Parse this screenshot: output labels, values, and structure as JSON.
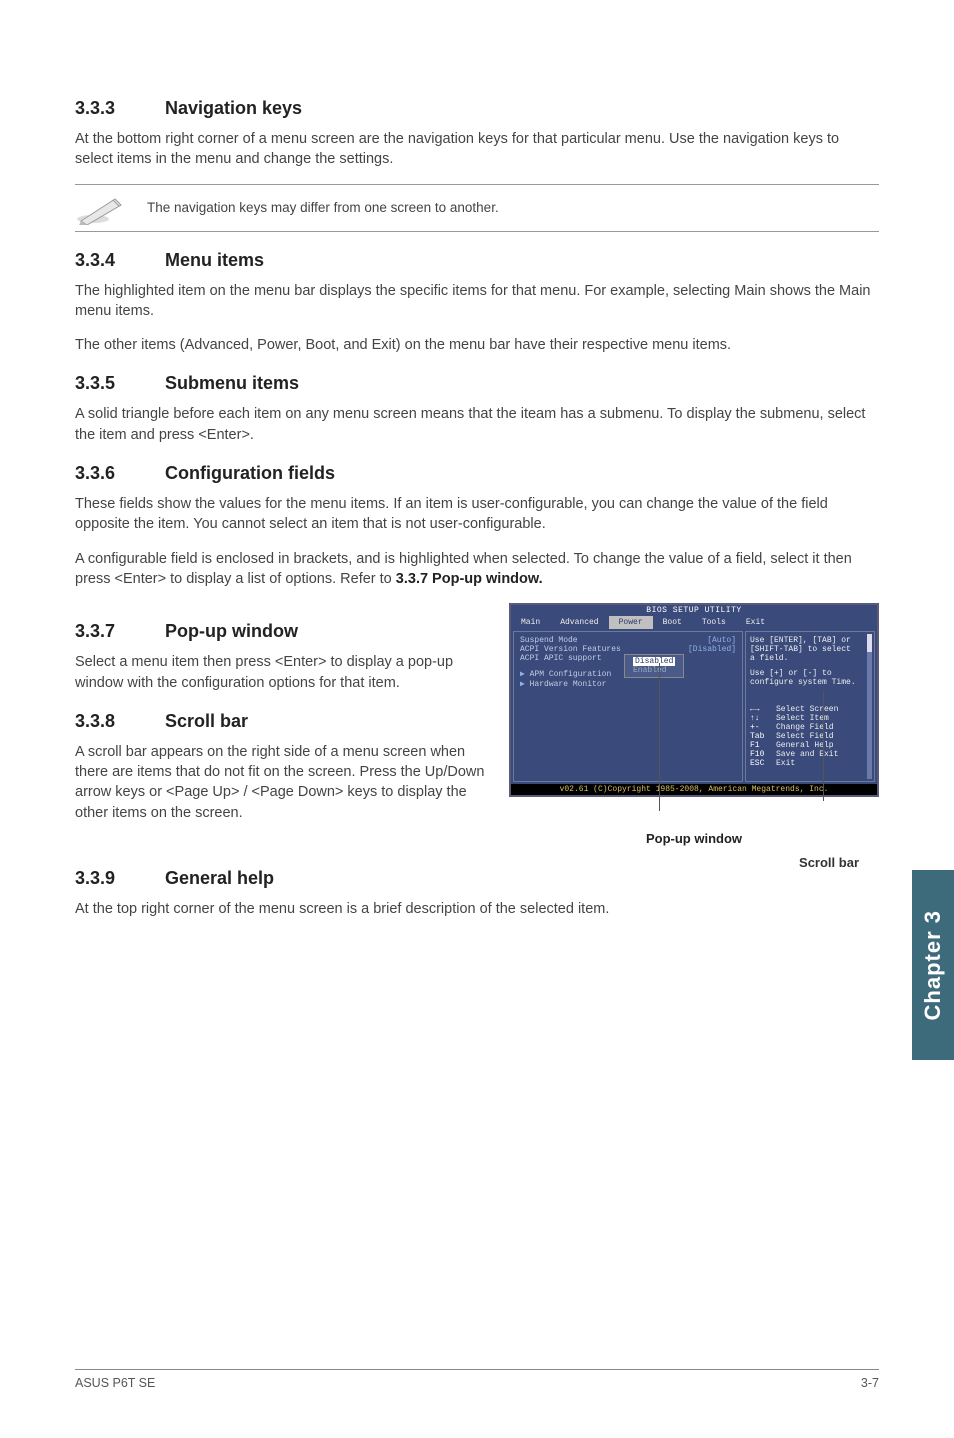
{
  "sections": {
    "s333": {
      "num": "3.3.3",
      "title": "Navigation keys",
      "p1": "At the bottom right corner of a menu screen are the navigation keys for that particular menu. Use the navigation keys to select items in the menu and change the settings.",
      "note": "The navigation keys may differ from one screen to another."
    },
    "s334": {
      "num": "3.3.4",
      "title": "Menu items",
      "p1": "The highlighted item on the menu bar displays the specific items for that menu. For example, selecting Main shows the Main menu items.",
      "p2": "The other items (Advanced, Power, Boot, and Exit) on the menu bar have their respective menu items."
    },
    "s335": {
      "num": "3.3.5",
      "title": "Submenu items",
      "p1": "A solid triangle before each item on any menu screen means that the iteam has a submenu. To display the submenu, select the item and press <Enter>."
    },
    "s336": {
      "num": "3.3.6",
      "title": "Configuration fields",
      "p1": "These fields show the values for the menu items. If an item is user-configurable, you can change the value of the field opposite the item. You cannot select an item that is not user-configurable.",
      "p2a": "A configurable field is enclosed in brackets, and is highlighted when selected. To change the value of a field, select it then press <Enter> to display a list of options. Refer to ",
      "p2b": "3.3.7 Pop-up window."
    },
    "s337": {
      "num": "3.3.7",
      "title": "Pop-up window",
      "p1": "Select a menu item then press <Enter> to display a pop-up window with the configuration options for that item."
    },
    "s338": {
      "num": "3.3.8",
      "title": "Scroll bar",
      "p1": "A scroll bar appears on the right side of a menu screen when there are items that do not fit on the screen. Press the Up/Down arrow keys or <Page Up> / <Page Down> keys to display the other items on the screen."
    },
    "s339": {
      "num": "3.3.9",
      "title": "General help",
      "p1": "At the top right corner of the menu screen is a brief description of the selected item."
    }
  },
  "sidetab": "Chapter 3",
  "bios": {
    "title": "BIOS SETUP UTILITY",
    "tabs": [
      "Main",
      "Advanced",
      "Power",
      "Boot",
      "Tools",
      "Exit"
    ],
    "activeTab": 2,
    "leftItems": [
      {
        "label": "Suspend Mode",
        "value": "[Auto]"
      },
      {
        "label": "ACPI Version Features",
        "value": "[Disabled]"
      },
      {
        "label": "ACPI APIC support",
        "value": "Disabled",
        "hi": true
      },
      {
        "label": "",
        "value": "Enabled",
        "dim": true
      }
    ],
    "subMenus": [
      "APM Configuration",
      "Hardware Monitor"
    ],
    "rightTop": [
      "Use [ENTER], [TAB] or",
      "[SHIFT-TAB] to select",
      "a field.",
      "",
      "Use [+] or [-] to",
      "configure system Time."
    ],
    "helpKeys": [
      {
        "k": "←→",
        "t": "Select Screen"
      },
      {
        "k": "↑↓",
        "t": "Select Item"
      },
      {
        "k": "+-",
        "t": "Change Field"
      },
      {
        "k": "Tab",
        "t": "Select Field"
      },
      {
        "k": "F1",
        "t": "General Help"
      },
      {
        "k": "F10",
        "t": "Save and Exit"
      },
      {
        "k": "ESC",
        "t": "Exit"
      }
    ],
    "status": "v02.61 (C)Copyright 1985-2008, American Megatrends, Inc.",
    "captionPopup": "Pop-up window",
    "captionScroll": "Scroll bar"
  },
  "footer": {
    "left": "ASUS P6T SE",
    "right": "3-7"
  }
}
